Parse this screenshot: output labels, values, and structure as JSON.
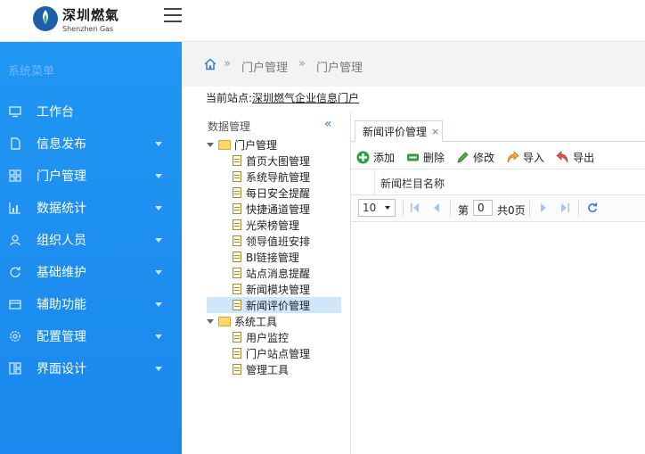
{
  "brand": {
    "name_cn": "深圳燃氣",
    "name_en": "Shenzhen Gas"
  },
  "sidebar": {
    "title": "系统菜单",
    "items": [
      {
        "label": "工作台",
        "icon": "monitor-icon",
        "has_submenu": false
      },
      {
        "label": "信息发布",
        "icon": "document-icon",
        "has_submenu": true
      },
      {
        "label": "门户管理",
        "icon": "grid-icon",
        "has_submenu": true
      },
      {
        "label": "数据统计",
        "icon": "bar-chart-icon",
        "has_submenu": true
      },
      {
        "label": "组织人员",
        "icon": "user-icon",
        "has_submenu": true
      },
      {
        "label": "基础维护",
        "icon": "refresh-icon",
        "has_submenu": true
      },
      {
        "label": "辅助功能",
        "icon": "box-icon",
        "has_submenu": true
      },
      {
        "label": "配置管理",
        "icon": "gear-icon",
        "has_submenu": true
      },
      {
        "label": "界面设计",
        "icon": "layout-icon",
        "has_submenu": true
      }
    ]
  },
  "breadcrumb": {
    "items": [
      "门户管理",
      "门户管理"
    ],
    "separator": "»"
  },
  "station": {
    "label": "当前站点:",
    "value": "深圳燃气企业信息门户"
  },
  "tree": {
    "header": "数据管理",
    "collapse_glyph": "«",
    "groups": [
      {
        "label": "门户管理",
        "children": [
          "首页大图管理",
          "系统导航管理",
          "每日安全提醒",
          "快捷通道管理",
          "光荣榜管理",
          "领导值班安排",
          "BI链接管理",
          "站点消息提醒",
          "新闻模块管理",
          "新闻评价管理"
        ]
      },
      {
        "label": "系统工具",
        "children": [
          "用户监控",
          "门户站点管理",
          "管理工具"
        ]
      }
    ],
    "selected": "新闻评价管理"
  },
  "tab": {
    "label": "新闻评价管理",
    "close": "×"
  },
  "toolbar": {
    "add": "添加",
    "delete": "删除",
    "edit": "修改",
    "import": "导入",
    "export": "导出"
  },
  "grid": {
    "columns": [
      "新闻栏目名称"
    ]
  },
  "pager": {
    "page_size": "10",
    "page_prefix": "第",
    "page_value": "0",
    "page_total": "共0页"
  },
  "colors": {
    "sidebar": "#1a88ee",
    "accent": "#3a7ad0",
    "selected": "#cfe6fb"
  }
}
